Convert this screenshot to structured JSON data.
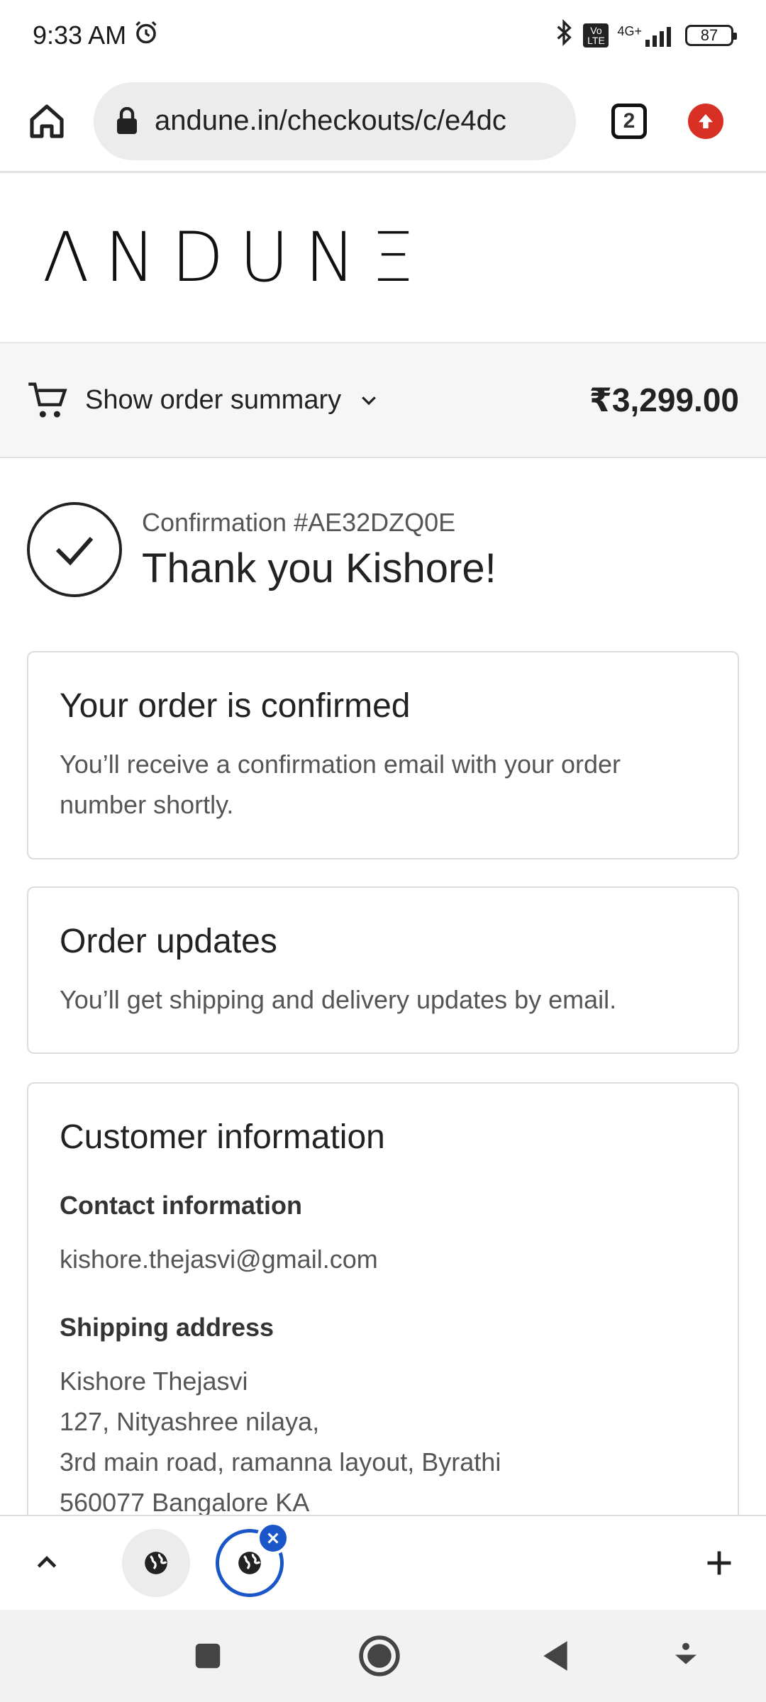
{
  "status_bar": {
    "time": "9:33 AM",
    "network": "4G+",
    "volte": "Vo LTE",
    "battery": "87"
  },
  "browser": {
    "url": "andune.in/checkouts/c/e4dc",
    "tab_count": "2"
  },
  "brand": {
    "logo_text": "ΛNDUNΞ"
  },
  "order_summary": {
    "toggle_label": "Show order summary",
    "total": "₹3,299.00"
  },
  "confirmation": {
    "number": "Confirmation #AE32DZQ0E",
    "thanks": "Thank you Kishore!"
  },
  "cards": {
    "confirmed": {
      "title": "Your order is confirmed",
      "body": "You’ll receive a confirmation email with your order number shortly."
    },
    "updates": {
      "title": "Order updates",
      "body": "You’ll get shipping and delivery updates by email."
    },
    "customer": {
      "title": "Customer information",
      "contact_heading": "Contact information",
      "contact_email": "kishore.thejasvi@gmail.com",
      "shipping_heading": "Shipping address",
      "address_lines": [
        "Kishore Thejasvi",
        "127, Nityashree nilaya,",
        "3rd main road, ramanna layout, Byrathi",
        "560077 Bangalore KA"
      ]
    }
  },
  "icons": {
    "home": "home-icon",
    "lock": "lock-icon",
    "cart": "cart-icon",
    "check": "check-icon",
    "globe": "globe-icon"
  },
  "colors": {
    "accent_blue": "#1a56c8",
    "update_red": "#d93025",
    "summary_bg": "#f6f6f6"
  }
}
